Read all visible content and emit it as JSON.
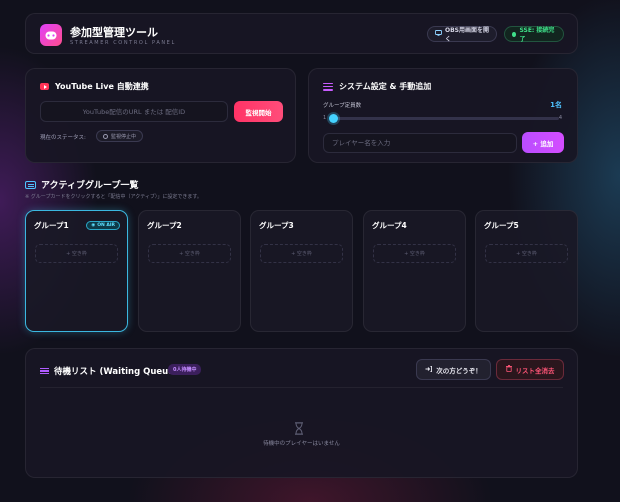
{
  "header": {
    "title": "参加型管理ツール",
    "subtitle": "STREAMER CONTROL PANEL",
    "obs_button": "OBS用画面を開く",
    "sse_status": "SSE: 接続完了"
  },
  "youtube": {
    "title": "YouTube Live 自動連携",
    "url_placeholder": "YouTube配信のURL または 配信ID",
    "url_value": "",
    "watch_button": "監視開始",
    "status_label": "現在のステータス:",
    "status_value": "監視停止中"
  },
  "settings": {
    "title": "システム設定 & 手動追加",
    "capacity_label": "グループ定員数",
    "capacity_value": "1名",
    "capacity_number": 1,
    "slider_min": "1",
    "slider_max": "4",
    "player_placeholder": "プレイヤー名を入力",
    "add_button": "追加"
  },
  "groups": {
    "title": "アクティブグループ一覧",
    "hint": "※ グループカードをクリックすると「配信中（アクティブ）」に設定できます。",
    "on_air_label": "ON AIR",
    "empty_slot": "+ 空き枠",
    "items": [
      {
        "name": "グループ1",
        "active": true
      },
      {
        "name": "グループ2",
        "active": false
      },
      {
        "name": "グループ3",
        "active": false
      },
      {
        "name": "グループ4",
        "active": false
      },
      {
        "name": "グループ5",
        "active": false
      }
    ]
  },
  "waiting": {
    "title": "待機リスト (Waiting Queue)",
    "count_badge": "0人待機中",
    "next_button": "次の方どうぞ！",
    "clear_button": "リスト全消去",
    "empty_message": "待機中のプレイヤーはいません"
  },
  "colors": {
    "accent_pink": "#ff3366",
    "accent_purple": "#c85cff",
    "accent_cyan": "#4fc3ff",
    "success_green": "#3fe08a"
  }
}
